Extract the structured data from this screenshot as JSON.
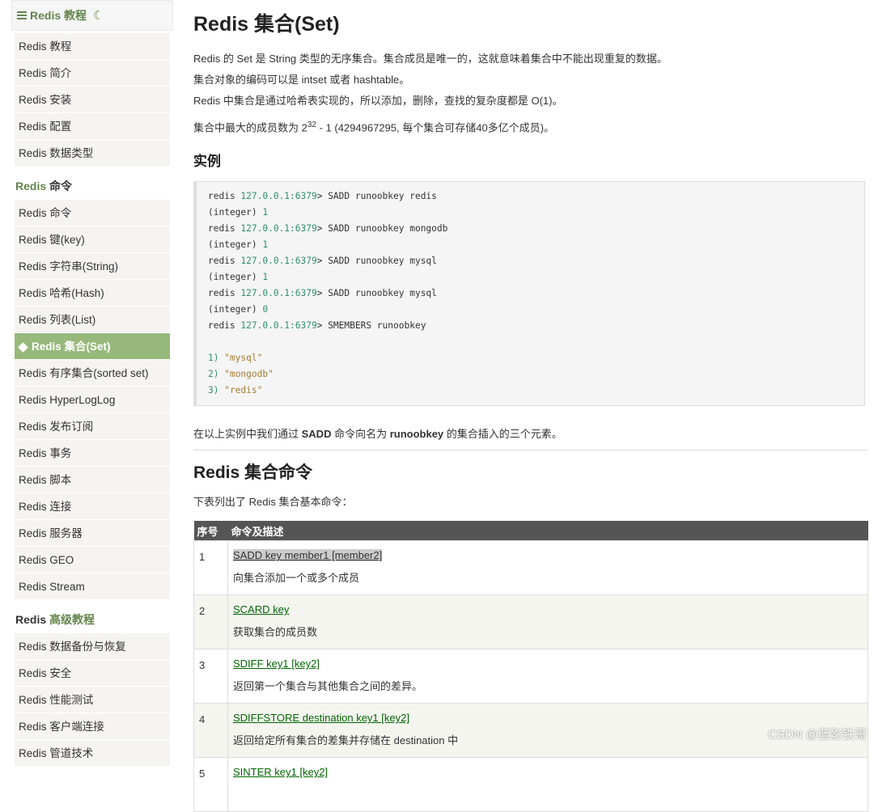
{
  "sidebar": {
    "title": "Redis 教程",
    "group1": [
      "Redis 教程",
      "Redis 简介",
      "Redis 安装",
      "Redis 配置",
      "Redis 数据类型"
    ],
    "section2_prefix": "Redis",
    "section2_title": "命令",
    "group2": [
      "Redis 命令",
      "Redis 键(key)",
      "Redis 字符串(String)",
      "Redis 哈希(Hash)",
      "Redis 列表(List)",
      "Redis 集合(Set)",
      "Redis 有序集合(sorted set)",
      "Redis HyperLogLog",
      "Redis 发布订阅",
      "Redis 事务",
      "Redis 脚本",
      "Redis 连接",
      "Redis 服务器",
      "Redis GEO",
      "Redis Stream"
    ],
    "active_item": "Redis 集合(Set)",
    "section3_prefix": "Redis",
    "section3_title": "高级教程",
    "group3": [
      "Redis 数据备份与恢复",
      "Redis 安全",
      "Redis 性能测试",
      "Redis 客户端连接",
      "Redis 管道技术"
    ]
  },
  "main": {
    "title": "Redis 集合(Set)",
    "p1": "Redis 的 Set 是 String 类型的无序集合。集合成员是唯一的，这就意味着集合中不能出现重复的数据。",
    "p2": "集合对象的编码可以是 intset 或者 hashtable。",
    "p3": "Redis 中集合是通过哈希表实现的，所以添加，删除，查找的复杂度都是 O(1)。",
    "p4_pre": "集合中最大的成员数为 2",
    "p4_sup": "32",
    "p4_post": " - 1 (4294967295, 每个集合可存储40多亿个成员)。",
    "example_heading": "实例",
    "code": {
      "prompt_prefix": "redis ",
      "ip": "127.0.0.1:6379",
      "lines": [
        {
          "type": "cmd",
          "text": "> SADD runoobkey redis"
        },
        {
          "type": "int",
          "text": "1"
        },
        {
          "type": "cmd",
          "text": "> SADD runoobkey mongodb"
        },
        {
          "type": "int",
          "text": "1"
        },
        {
          "type": "cmd",
          "text": "> SADD runoobkey mysql"
        },
        {
          "type": "int",
          "text": "1"
        },
        {
          "type": "cmd",
          "text": "> SADD runoobkey mysql"
        },
        {
          "type": "int",
          "text": "0"
        },
        {
          "type": "cmd",
          "text": "> SMEMBERS runoobkey"
        }
      ],
      "int_label": "(integer) ",
      "results": [
        {
          "idx": "1) ",
          "val": "\"mysql\""
        },
        {
          "idx": "2) ",
          "val": "\"mongodb\""
        },
        {
          "idx": "3) ",
          "val": "\"redis\""
        }
      ]
    },
    "after_pre": "在以上实例中我们通过 ",
    "after_b1": "SADD",
    "after_mid": " 命令向名为 ",
    "after_b2": "runoobkey",
    "after_post": " 的集合插入的三个元素。",
    "commands_heading": "Redis 集合命令",
    "commands_intro": "下表列出了 Redis 集合基本命令：",
    "table": {
      "headers": [
        "序号",
        "命令及描述"
      ],
      "rows": [
        {
          "n": "1",
          "cmd": "SADD key member1 [member2]",
          "desc": "向集合添加一个或多个成员"
        },
        {
          "n": "2",
          "cmd": "SCARD key",
          "desc": "获取集合的成员数"
        },
        {
          "n": "3",
          "cmd": "SDIFF key1 [key2]",
          "desc": "返回第一个集合与其他集合之间的差异。"
        },
        {
          "n": "4",
          "cmd": "SDIFFSTORE destination key1 [key2]",
          "desc": "返回给定所有集合的差集并存储在 destination 中"
        },
        {
          "n": "5",
          "cmd": "SINTER key1 [key2]",
          "desc": ""
        }
      ]
    }
  },
  "watermark": "CSDN @蓝影铁哥"
}
